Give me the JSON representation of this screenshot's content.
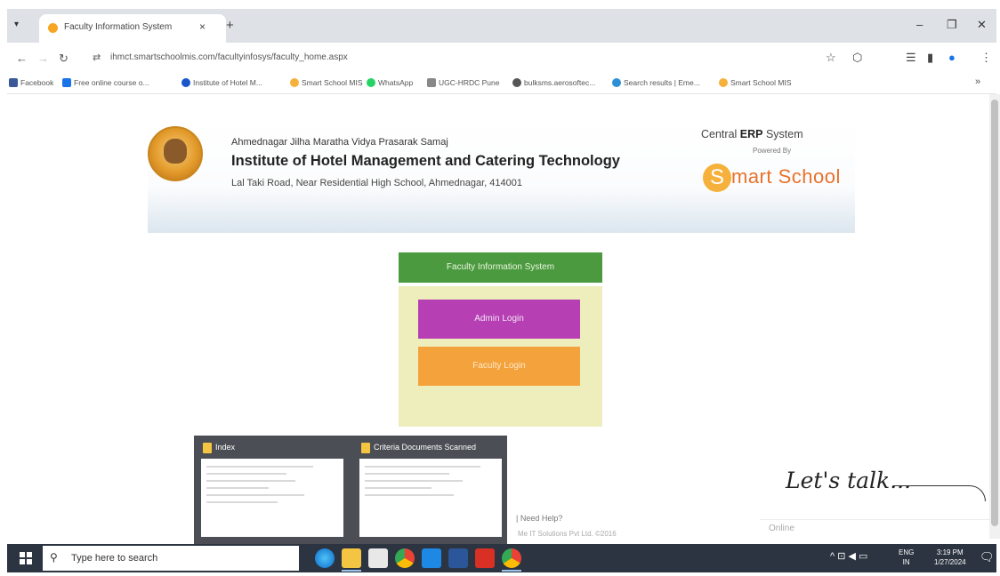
{
  "browser": {
    "tab_title": "Faculty Information System",
    "tab_close": "×",
    "new_tab": "+",
    "url": "ihmct.smartschoolmis.com/facultyinfosys/faculty_home.aspx",
    "bookmarks": [
      {
        "label": "Facebook",
        "color": "#3b5998"
      },
      {
        "label": "Free online course o...",
        "color": "#1a73e8"
      },
      {
        "label": "Institute of Hotel M...",
        "color": "#1a56c9"
      },
      {
        "label": "Smart School MIS",
        "color": "#f6b13c"
      },
      {
        "label": "WhatsApp",
        "color": "#25d366"
      },
      {
        "label": "UGC-HRDC Pune",
        "color": "#888888"
      },
      {
        "label": "bulksms.aerosoftec...",
        "color": "#555555"
      },
      {
        "label": "Search results | Eme...",
        "color": "#2d8fd5"
      },
      {
        "label": "Smart School MIS",
        "color": "#f6b13c"
      }
    ],
    "bookmarks_more": "»"
  },
  "header": {
    "org": "Ahmednagar Jilha Maratha Vidya Prasarak Samaj",
    "institute": "Institute of Hotel Management and Catering Technology",
    "address": "Lal Taki Road, Near Residential High School, Ahmednagar, 414001",
    "erp_prefix": "Central ",
    "erp_bold": "ERP",
    "erp_suffix": " System",
    "powered_by": "Powered By",
    "brand_s": "S",
    "brand_rest": "mart School"
  },
  "login": {
    "title": "Faculty Information System",
    "admin_label": "Admin Login",
    "faculty_label": "Faculty Login"
  },
  "footer": {
    "need_help": "| Need Help?",
    "copyright": "Me IT Solutions Pvt Ltd. ©2016"
  },
  "chat": {
    "lets_talk": "Let's talk...",
    "status": "Online"
  },
  "previews": [
    {
      "title": "Index"
    },
    {
      "title": "Criteria Documents Scanned"
    }
  ],
  "taskbar": {
    "search_placeholder": "Type here to search",
    "apps": [
      "edge-icon",
      "file-explorer-icon",
      "store-icon",
      "chrome-icon",
      "mail-icon",
      "word-icon",
      "acrobat-icon",
      "chrome-profile-icon"
    ],
    "lang_top": "ENG",
    "lang_bottom": "IN",
    "time": "3:19 PM",
    "date": "1/27/2024"
  },
  "colors": {
    "fis_green": "#4c9a3f",
    "admin_purple": "#b53fb3",
    "faculty_orange": "#f4a23c",
    "panel_bg": "#eeeebc",
    "brand_orange": "#e8722b"
  }
}
